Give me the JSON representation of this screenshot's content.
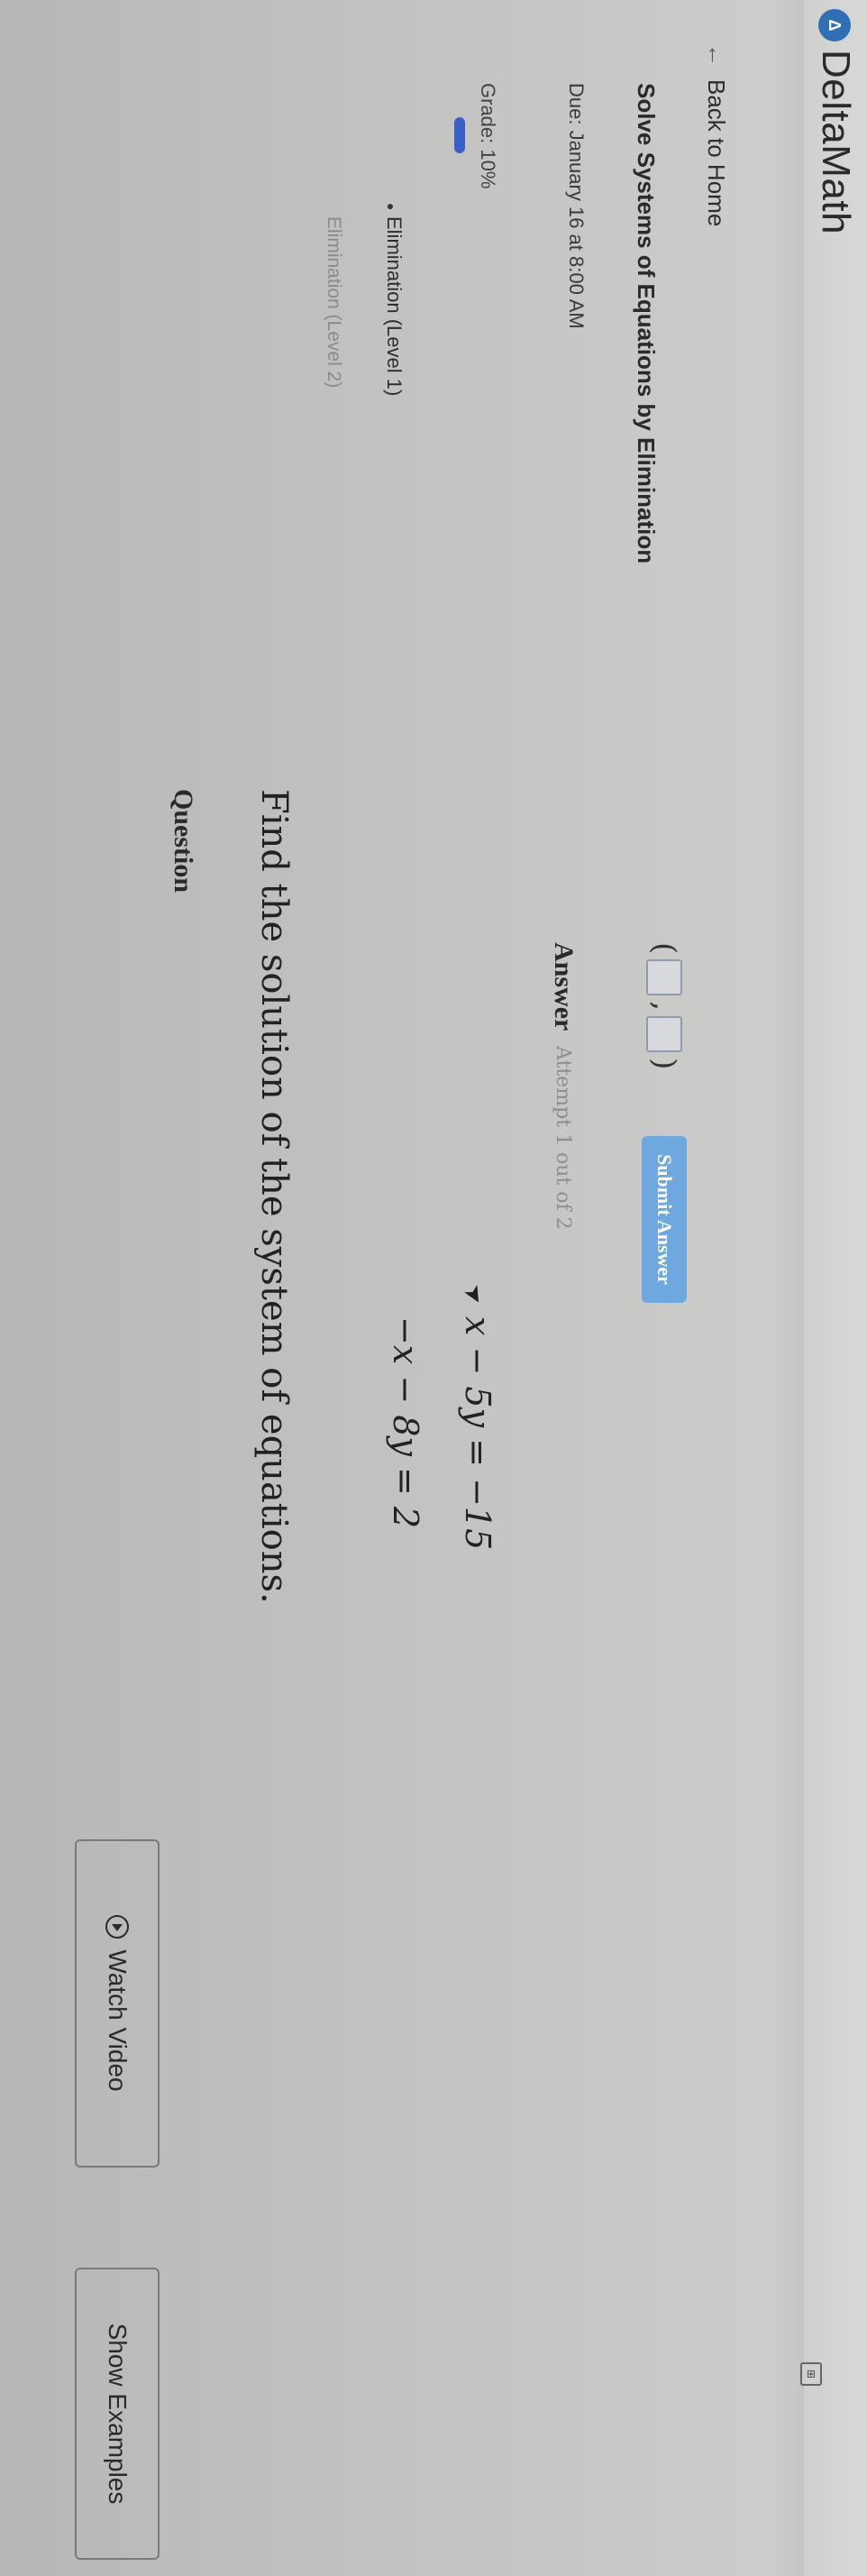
{
  "header": {
    "logo_glyph": "Δ",
    "brand": "DeltaMath"
  },
  "sidebar": {
    "back_arrow": "←",
    "back_label": "Back to Home",
    "assignment_title": "Solve Systems of Equations by Elimination",
    "due": "Due: January 16 at 8:00 AM",
    "grade": "Grade: 10%",
    "grade_value": 0.1,
    "skills": [
      {
        "label": "Elimination (Level 1)",
        "active": true
      },
      {
        "label": "Elimination (Level 2)",
        "active": false
      }
    ]
  },
  "question": {
    "label": "Question",
    "prompt": "Find the solution of the system of equations.",
    "equations": [
      "−x − 8y = 2",
      "x − 5y = −15"
    ]
  },
  "answer": {
    "label": "Answer",
    "attempt": "Attempt 1 out of 2",
    "open_paren": "(",
    "comma": ",",
    "close_paren": ")",
    "submit_label": "Submit Answer"
  },
  "actions": {
    "watch_video": "Watch Video",
    "show_examples": "Show Examples",
    "calc_glyph": "⊞"
  },
  "colors": {
    "accent": "#3a5fc9",
    "submit": "#6ea8de",
    "logo": "#2f6fb5"
  }
}
